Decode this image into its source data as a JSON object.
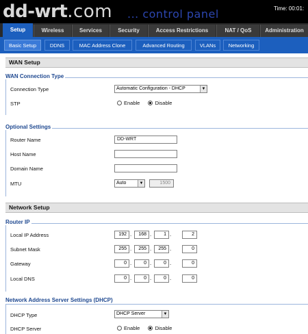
{
  "header": {
    "logo_main": "dd-wrt",
    "logo_suffix": ".com",
    "control_panel": "... control panel",
    "time": "Time: 00:01:"
  },
  "tabs": [
    {
      "label": "Setup",
      "active": true
    },
    {
      "label": "Wireless"
    },
    {
      "label": "Services"
    },
    {
      "label": "Security"
    },
    {
      "label": "Access Restrictions"
    },
    {
      "label": "NAT / QoS"
    },
    {
      "label": "Administration"
    }
  ],
  "subtabs": [
    {
      "label": "Basic Setup",
      "active": true
    },
    {
      "label": "DDNS"
    },
    {
      "label": "MAC Address Clone"
    },
    {
      "label": "Advanced Routing"
    },
    {
      "label": "VLANs"
    },
    {
      "label": "Networking"
    }
  ],
  "wan_setup": {
    "title": "WAN Setup",
    "connection_type": {
      "legend": "WAN Connection Type",
      "label": "Connection Type",
      "value": "Automatic Configuration - DHCP",
      "stp_label": "STP",
      "enable_label": "Enable",
      "disable_label": "Disable",
      "stp_enabled": false
    },
    "optional": {
      "legend": "Optional Settings",
      "router_name_label": "Router Name",
      "router_name": "DD-WRT",
      "host_name_label": "Host Name",
      "host_name": "",
      "domain_name_label": "Domain Name",
      "domain_name": "",
      "mtu_label": "MTU",
      "mtu_mode": "Auto",
      "mtu_value": "1500"
    }
  },
  "network_setup": {
    "title": "Network Setup",
    "router_ip": {
      "legend": "Router IP",
      "local_ip_label": "Local IP Address",
      "local_ip": [
        "192",
        "168",
        "1",
        "2"
      ],
      "subnet_label": "Subnet Mask",
      "subnet": [
        "255",
        "255",
        "255",
        "0"
      ],
      "gateway_label": "Gateway",
      "gateway": [
        "0",
        "0",
        "0",
        "0"
      ],
      "dns_label": "Local DNS",
      "dns": [
        "0",
        "0",
        "0",
        "0"
      ]
    },
    "dhcp": {
      "legend": "Network Address Server Settings (DHCP)",
      "type_label": "DHCP Type",
      "type_value": "DHCP Server",
      "server_label": "DHCP Server",
      "enable_label": "Enable",
      "disable_label": "Disable",
      "server_enabled": false
    }
  },
  "colors": {
    "tab_active": "#1c5fbe",
    "legend": "#1e4890",
    "control_panel": "#2c46b0"
  }
}
